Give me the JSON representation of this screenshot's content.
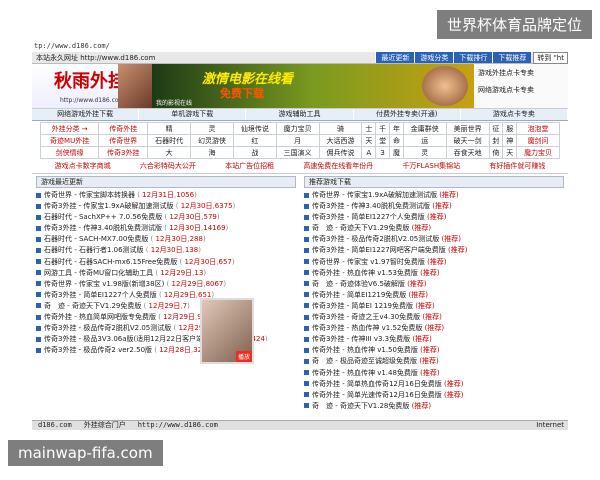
{
  "watermark_top": "世界杯体育品牌定位",
  "watermark_bottom": "mainwap-fifa.com",
  "top_url": "tp://www.d186.com/",
  "topbar": {
    "home_text": "本站永久网址 http://www.d186.com",
    "nav": [
      "最近更新",
      "游戏分类",
      "下载排行",
      "下载推荐"
    ],
    "favorite": "转到 \"ht"
  },
  "banner": {
    "logo_title": "秋雨外挂网",
    "logo_domain": "http://www.d186.com",
    "ad_line1": "激情电影在线看",
    "ad_line2": "免费下载",
    "ad_line3": "我的影视在线",
    "side": [
      "游戏外挂点卡专卖",
      "网络游戏点卡专卖"
    ]
  },
  "navbar": [
    "网络游戏外挂下载",
    "单机游戏下载",
    "游戏辅助工具",
    "付费外挂专卖(开通)",
    "游戏点卡专卖"
  ],
  "grid": [
    [
      "外挂分类 →",
      "传奇外挂",
      "精",
      "灵",
      "仙境传说",
      "魔力宝贝",
      "骑",
      "士",
      "千",
      "年",
      "金庸群侠",
      "美丽世界",
      "征",
      "服",
      "泡泡堂"
    ],
    [
      "奇迹MU外挂",
      "传奇世界",
      "石器时代",
      "幻灵游侠",
      "红",
      "月",
      "大话西游",
      "天",
      "堂",
      "命",
      "运",
      "破天一剑",
      "封",
      "神",
      "魔剑问"
    ],
    [
      "剑侠情缘",
      "传奇3外挂",
      "大",
      "海",
      "战",
      "三国演义",
      "佣兵传说",
      "A",
      "3",
      "魔",
      "灵",
      "吞食天地",
      "倚",
      "天",
      "魔力宝贝"
    ]
  ],
  "promo": [
    "游戏点卡数字商城",
    "六合彩特码大公开",
    "本站广告位招租",
    "高速免费在线看年份丹",
    "千万FLASH集锦站",
    "有好插件就可赚钱"
  ],
  "left": {
    "title": "游戏最近更新",
    "items": [
      {
        "name": "传奇世界 - 传家宝脚本转换器",
        "date": "12月31日",
        "count": "1056"
      },
      {
        "name": "传奇3外挂 - 传家宝1.9xA破解加速测试版",
        "date": "12月30日",
        "count": "6375"
      },
      {
        "name": "石器时代 - SachXP++ 7.0.56免费版",
        "date": "12月30日",
        "count": "579"
      },
      {
        "name": "传奇3外挂 - 传神3.40脱机免费测试版",
        "date": "12月30日",
        "count": "14169"
      },
      {
        "name": "石器时代 - SACH-MX7.00免费版",
        "date": "12月30日",
        "count": "288"
      },
      {
        "name": "石器时代 - 石器行者1.06测试版",
        "date": "12月30日",
        "count": "138"
      },
      {
        "name": "石器时代 - 石器SACH-mx6.15Free免费版",
        "date": "12月30日",
        "count": "657"
      },
      {
        "name": "网游工具 - 传奇MU窗口化辅助工具",
        "date": "12月29日",
        "count": "13"
      },
      {
        "name": "传奇世界 - 传家宝 v1.98版(新增38区)",
        "date": "12月29日",
        "count": "8067"
      },
      {
        "name": "传奇3外挂 - 简单EI1227个人免费版",
        "date": "12月29日",
        "count": "651"
      },
      {
        "name": "奇　迹 - 奇迹天下V1.29免费版",
        "date": "12月29日",
        "count": "7"
      },
      {
        "name": "传奇外挂 - 热血简单网吧版专免费版",
        "date": "12月29日",
        "count": "95"
      },
      {
        "name": "传奇3外挂 - 极品传奇2脱机V2.05测试版",
        "date": "12月29日",
        "count": "7809"
      },
      {
        "name": "传奇3外挂 - 极品3V3.06a版(适用12月22日客户端)",
        "date": "12月28日",
        "count": "8424"
      },
      {
        "name": "传奇3外挂 - 极品传奇2 ver2.50版",
        "date": "12月28日",
        "count": "3237"
      }
    ]
  },
  "right": {
    "title": "推荐游戏下载",
    "tag": "推荐",
    "items": [
      "传奇世界 - 传家宝1.9xA破解加速测试版",
      "传奇3外挂 - 传神3.40脱机免费测试版",
      "传奇3外挂 - 简单EI1227个人免费版",
      "奇　迹 - 奇迹天下V1.29免费版",
      "传奇3外挂 - 极品传奇2脱机V2.05测试版",
      "传奇3外挂 - 简单EI1227网吧客户端免费版",
      "传奇世界 - 传家宝 v1.97智时免费版",
      "传奇外挂 - 热血传神 v1.53免费版",
      "奇　迹 - 奇迹体验V6.5破解版",
      "传奇外挂 - 简单EI1219免费版",
      "传奇3外挂 - 简单EI 1219免费版",
      "传奇3外挂 - 奇迹之王v4.30免费版",
      "传奇3外挂 - 热血传神 v1.52免费版",
      "传奇3外挂 - 传神III v3.3免费版",
      "传奇外挂 - 热血传神 v1.50免费版",
      "奇　迹 - 极品奇迹至诚超级免费版",
      "传奇外挂 - 热血传神 v1.48免费版",
      "传奇外挂 - 简单热血传奇12月16日免费版",
      "传奇外挂 - 简单光速传奇12月16日免费版",
      "奇　迹 - 奇迹天下V1.28免费版"
    ]
  },
  "popup_tag": "播放",
  "status": {
    "left": "d186.com",
    "mid": "外挂综合门户",
    "url": "http://www.d186.com",
    "inet": "Internet"
  }
}
